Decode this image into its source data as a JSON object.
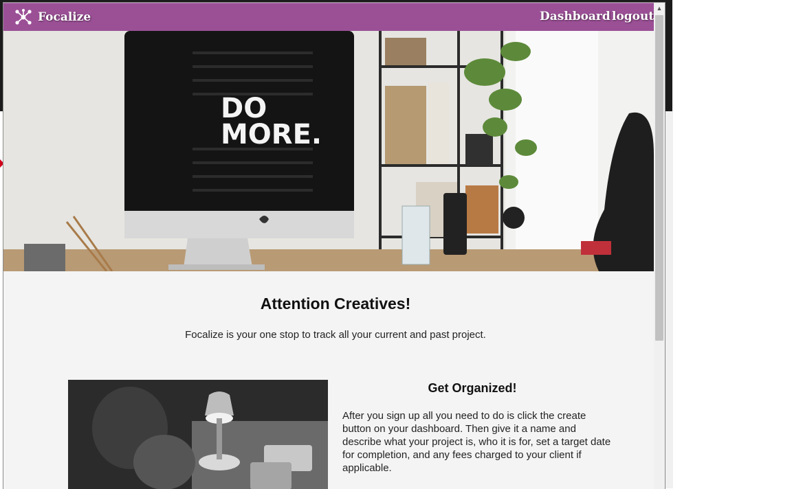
{
  "navbar": {
    "brand": "Focalize",
    "brand_icon": "molecule-icon",
    "links": [
      "Dashboard",
      "logout"
    ],
    "color": "#9b5096"
  },
  "hero": {
    "screen_text_line1": "DO",
    "screen_text_line2": "MORE."
  },
  "intro": {
    "headline": "Attention Creatives!",
    "tagline": "Focalize is your one stop to track all your current and past project."
  },
  "feature": {
    "title": "Get Organized!",
    "body": "After you sign up all you need to do is click the create button on your dashboard. Then give it a name and describe what your project is, who it is for, set a target date for completion, and any fees charged to your client if applicable."
  }
}
